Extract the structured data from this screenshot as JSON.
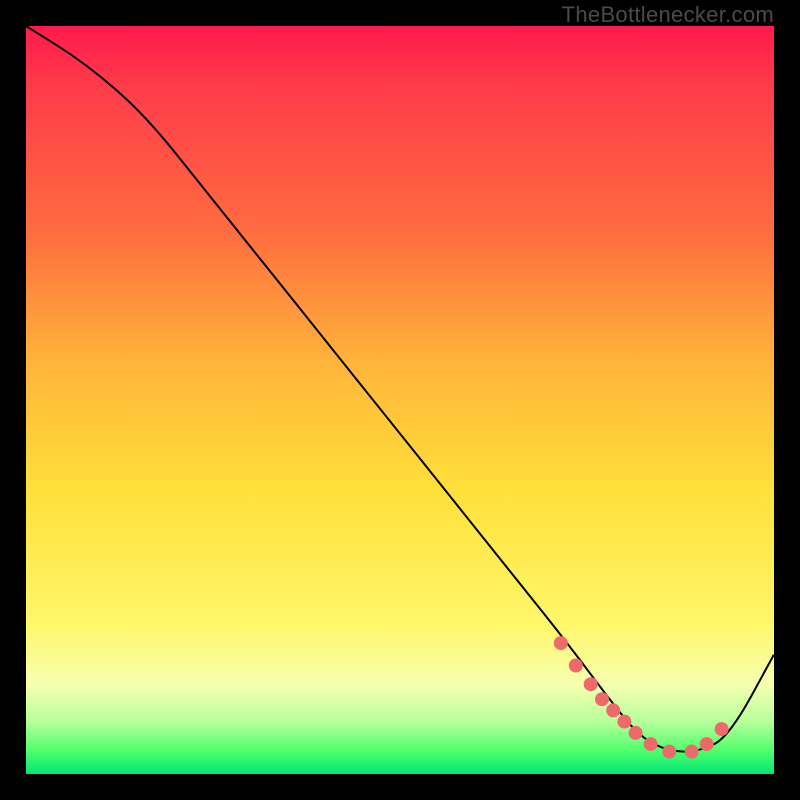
{
  "attribution": "TheBottlenecker.com",
  "chart_data": {
    "type": "line",
    "title": "",
    "xlabel": "",
    "ylabel": "",
    "xlim": [
      0,
      100
    ],
    "ylim": [
      0,
      100
    ],
    "series": [
      {
        "name": "curve",
        "x": [
          0,
          8,
          16,
          24,
          32,
          40,
          48,
          56,
          64,
          72,
          78,
          82,
          86,
          90,
          94,
          100
        ],
        "y": [
          100,
          95,
          88,
          78,
          68,
          58,
          48,
          38,
          28,
          18,
          10,
          5,
          3,
          3,
          5,
          16
        ]
      }
    ],
    "markers": {
      "name": "highlight-points",
      "color": "#ee6a6a",
      "radius": 7,
      "x": [
        71.5,
        73.5,
        75.5,
        77,
        78.5,
        80,
        81.5,
        83.5,
        86,
        89,
        91,
        93
      ],
      "y": [
        17.5,
        14.5,
        12,
        10,
        8.5,
        7,
        5.5,
        4,
        3,
        3,
        4,
        6
      ]
    }
  },
  "colors": {
    "curve": "#000000",
    "marker": "#ee6a6a"
  }
}
